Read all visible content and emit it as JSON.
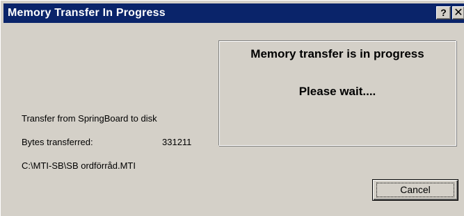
{
  "window": {
    "title": "Memory Transfer In Progress",
    "help_label": "?",
    "close_label": "✕"
  },
  "message": {
    "line1": "Memory transfer is in progress",
    "line2": "Please wait...."
  },
  "info": {
    "transfer_text": "Transfer from SpringBoard to disk",
    "bytes_label": "Bytes transferred:",
    "bytes_value": "331211",
    "file_path": "C:\\MTI-SB\\SB ordförråd.MTI"
  },
  "buttons": {
    "cancel_label": "Cancel"
  },
  "colors": {
    "titlebar": "#0a246a",
    "dialog_face": "#d4d0c8"
  }
}
